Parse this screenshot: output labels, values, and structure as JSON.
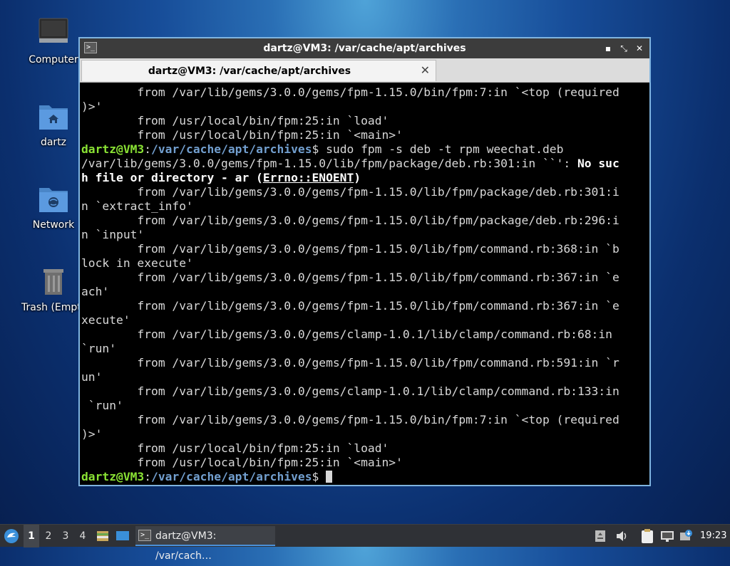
{
  "desktop": {
    "icons": [
      {
        "label": "Computer",
        "icon": "computer-icon"
      },
      {
        "label": "dartz",
        "icon": "home-folder-icon"
      },
      {
        "label": "Network",
        "icon": "network-folder-icon"
      },
      {
        "label": "Trash (Empty)",
        "icon": "trash-icon"
      }
    ]
  },
  "window": {
    "title": "dartz@VM3: /var/cache/apt/archives",
    "tab_label": "dartz@VM3: /var/cache/apt/archives",
    "controls": {
      "minimize": "▪",
      "maximize": "⤡",
      "close": "✕"
    }
  },
  "terminal": {
    "prompt_user": "dartz@VM3",
    "prompt_sep": ":",
    "prompt_path": "/var/cache/apt/archives",
    "prompt_end": "$",
    "command": " sudo fpm -s deb -t rpm weechat.deb",
    "lines_before": [
      "        from /var/lib/gems/3.0.0/gems/fpm-1.15.0/bin/fpm:7:in `<top (required",
      ")>'",
      "        from /usr/local/bin/fpm:25:in `load'",
      "        from /usr/local/bin/fpm:25:in `<main>'"
    ],
    "error_line1_a": "/var/lib/gems/3.0.0/gems/fpm-1.15.0/lib/fpm/package/deb.rb:301:in ``': ",
    "error_line1_b": "No suc",
    "error_line2_a": "h file or directory - ar (",
    "error_line2_b": "Errno::ENOENT",
    "error_line2_c": ")",
    "trace": [
      "        from /var/lib/gems/3.0.0/gems/fpm-1.15.0/lib/fpm/package/deb.rb:301:i",
      "n `extract_info'",
      "        from /var/lib/gems/3.0.0/gems/fpm-1.15.0/lib/fpm/package/deb.rb:296:i",
      "n `input'",
      "        from /var/lib/gems/3.0.0/gems/fpm-1.15.0/lib/fpm/command.rb:368:in `b",
      "lock in execute'",
      "        from /var/lib/gems/3.0.0/gems/fpm-1.15.0/lib/fpm/command.rb:367:in `e",
      "ach'",
      "        from /var/lib/gems/3.0.0/gems/fpm-1.15.0/lib/fpm/command.rb:367:in `e",
      "xecute'",
      "        from /var/lib/gems/3.0.0/gems/clamp-1.0.1/lib/clamp/command.rb:68:in",
      "`run'",
      "        from /var/lib/gems/3.0.0/gems/fpm-1.15.0/lib/fpm/command.rb:591:in `r",
      "un'",
      "        from /var/lib/gems/3.0.0/gems/clamp-1.0.1/lib/clamp/command.rb:133:in",
      " `run'",
      "        from /var/lib/gems/3.0.0/gems/fpm-1.15.0/bin/fpm:7:in `<top (required",
      ")>'",
      "        from /usr/local/bin/fpm:25:in `load'",
      "        from /usr/local/bin/fpm:25:in `<main>'"
    ]
  },
  "taskbar": {
    "workspaces": [
      "1",
      "2",
      "3",
      "4"
    ],
    "active_workspace": "1",
    "task_label": "dartz@VM3: /var/cach…",
    "clock": "19:23"
  }
}
